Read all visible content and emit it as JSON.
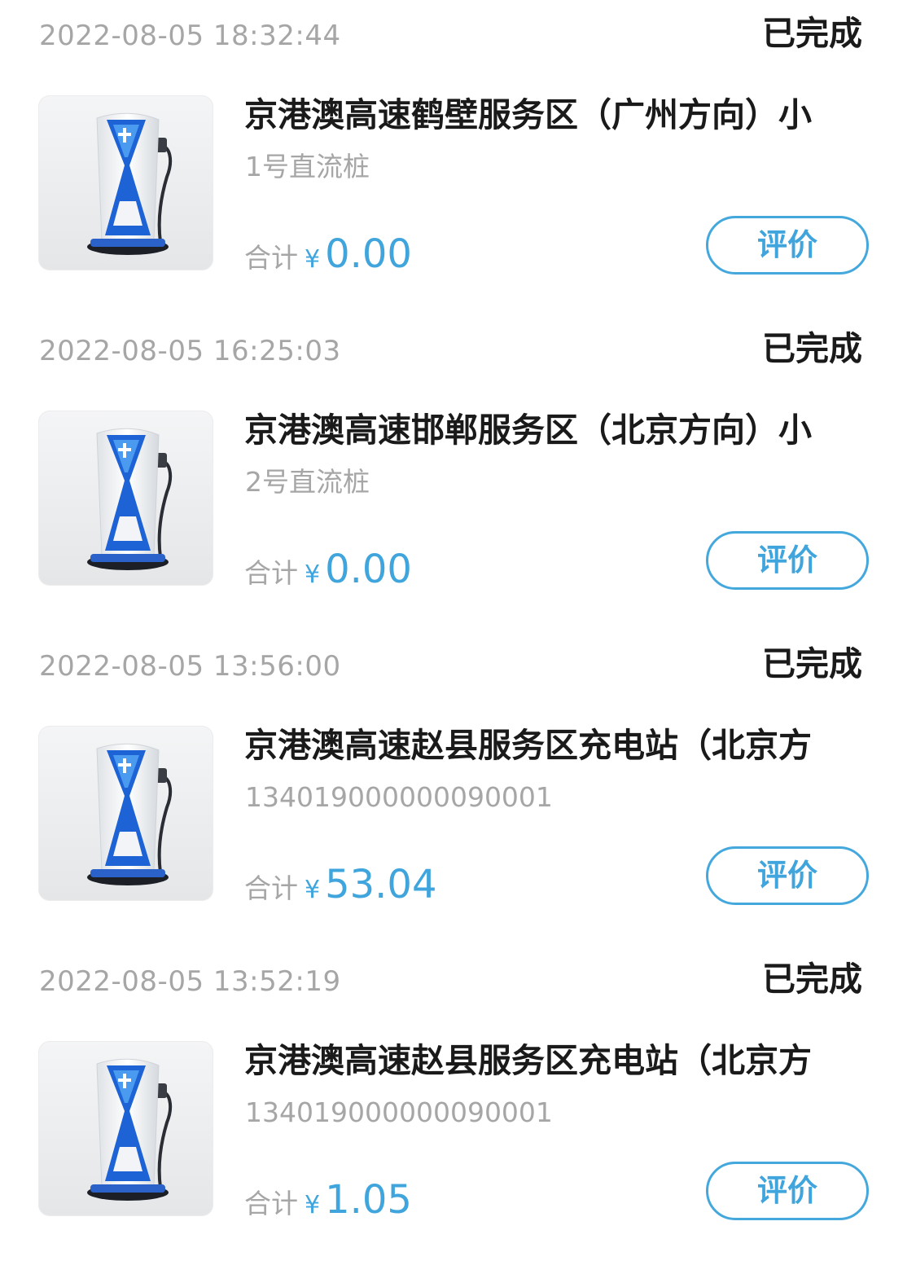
{
  "orders": [
    {
      "time": "2022-08-05 18:32:44",
      "status": "已完成",
      "station": "京港澳高速鹤壁服务区（广州方向）小",
      "pile": "1号直流桩",
      "total_label": "合计",
      "currency": "¥",
      "amount": "0.00",
      "review_label": "评价"
    },
    {
      "time": "2022-08-05 16:25:03",
      "status": "已完成",
      "station": "京港澳高速邯郸服务区（北京方向）小",
      "pile": "2号直流桩",
      "total_label": "合计",
      "currency": "¥",
      "amount": "0.00",
      "review_label": "评价"
    },
    {
      "time": "2022-08-05 13:56:00",
      "status": "已完成",
      "station": "京港澳高速赵县服务区充电站（北京方",
      "pile": "134019000000090001",
      "total_label": "合计",
      "currency": "¥",
      "amount": "53.04",
      "review_label": "评价"
    },
    {
      "time": "2022-08-05 13:52:19",
      "status": "已完成",
      "station": "京港澳高速赵县服务区充电站（北京方",
      "pile": "134019000000090001",
      "total_label": "合计",
      "currency": "¥",
      "amount": "1.05",
      "review_label": "评价"
    }
  ],
  "colors": {
    "accent": "#3fa5dc",
    "muted_text": "#a6a6a6",
    "primary_text": "#1a1a1a"
  },
  "icons": {
    "thumbnail": "ev-charger-icon"
  }
}
